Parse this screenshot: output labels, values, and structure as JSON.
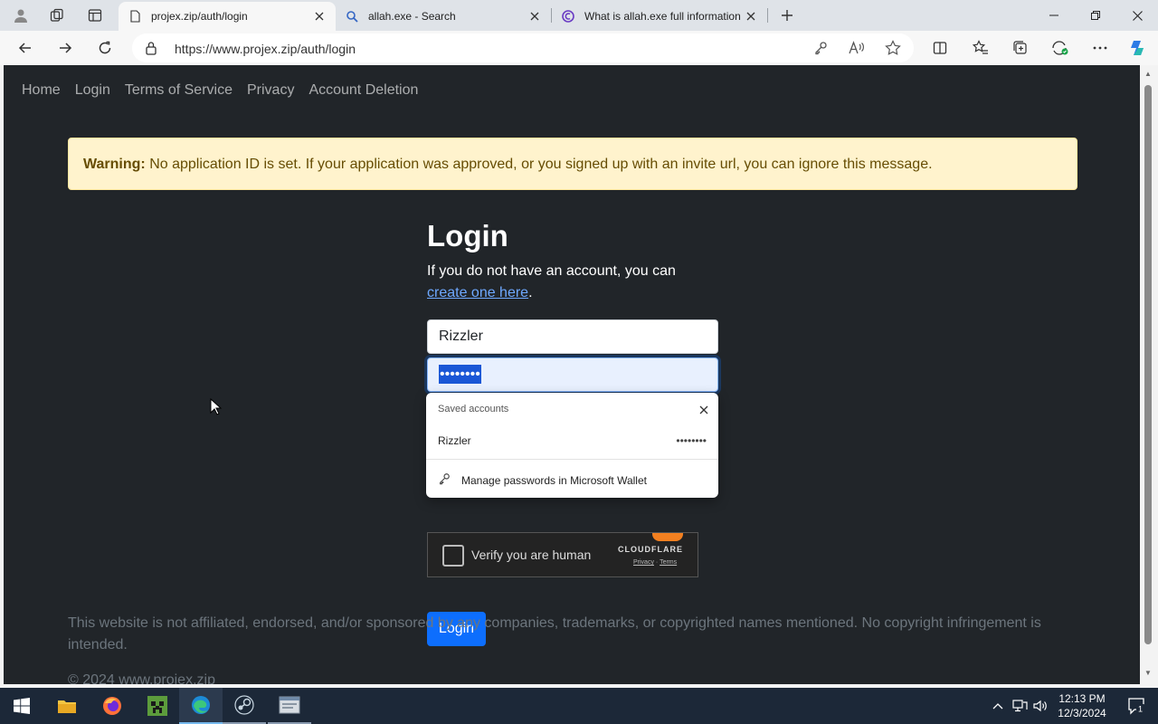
{
  "browser": {
    "tabs": [
      {
        "title": "projex.zip/auth/login",
        "active": true
      },
      {
        "title": "allah.exe - Search",
        "active": false
      },
      {
        "title": "What is allah.exe full information",
        "active": false
      }
    ],
    "url": "https://www.projex.zip/auth/login"
  },
  "site": {
    "nav": [
      "Home",
      "Login",
      "Terms of Service",
      "Privacy",
      "Account Deletion"
    ],
    "alert": {
      "label": "Warning:",
      "text": "No application ID is set. If your application was approved, or you signed up with an invite url, you can ignore this message."
    },
    "login": {
      "title": "Login",
      "subtitle_prefix": "If you do not have an account, you can ",
      "subtitle_link": "create one here",
      "subtitle_suffix": ".",
      "username_value": "Rizzler",
      "password_value": "••••••••",
      "button": "Login"
    },
    "turnstile": {
      "label": "Verify you are human",
      "brand": "CLOUDFLARE",
      "privacy": "Privacy",
      "terms": "Terms",
      "link_separator": "·"
    },
    "footer": "This website is not affiliated, endorsed, and/or sponsored by any companies, trademarks, or copyrighted names mentioned. No copyright infringement is intended.",
    "copyright": "© 2024 www.projex.zip"
  },
  "password_popup": {
    "header": "Saved accounts",
    "account_username": "Rizzler",
    "account_password": "••••••••",
    "manage_label": "Manage passwords in Microsoft Wallet"
  },
  "taskbar": {
    "time": "12:13 PM",
    "date": "12/3/2024",
    "notification_count": "1",
    "apps": [
      "file-explorer",
      "firefox",
      "minecraft",
      "edge",
      "steam",
      "app"
    ]
  },
  "colors": {
    "page_bg": "#212529",
    "alert_bg": "#fff3cd",
    "primary": "#0d6efd",
    "link": "#6ea8fe"
  }
}
